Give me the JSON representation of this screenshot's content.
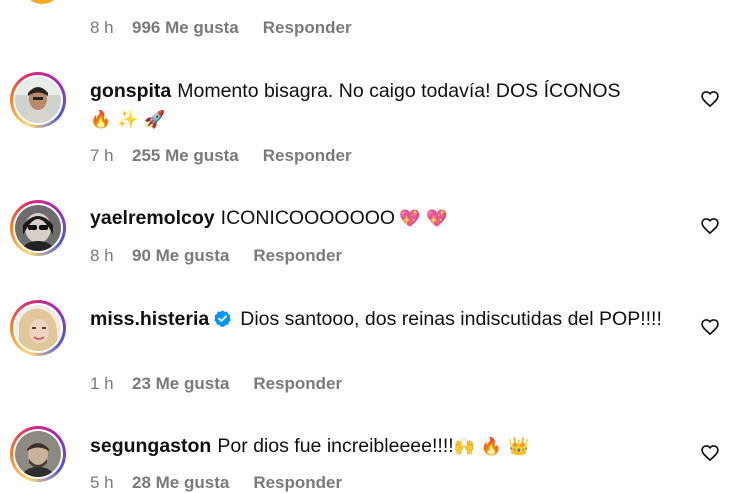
{
  "top_comment": {
    "time": "8 h",
    "likes": "996 Me gusta",
    "reply": "Responder"
  },
  "comments": [
    {
      "username": "gonspita",
      "text": "Momento bisagra. No caigo todavía! DOS ÍCONOS",
      "emojis": [
        "🔥",
        "✨",
        "🚀"
      ],
      "time": "7 h",
      "likes": "255 Me gusta",
      "reply": "Responder",
      "verified": false
    },
    {
      "username": "yaelremolcoy",
      "text": "ICONICOOOOOOO",
      "emojis": [
        "💖",
        "💖"
      ],
      "time": "8 h",
      "likes": "90 Me gusta",
      "reply": "Responder",
      "verified": false
    },
    {
      "username": "miss.histeria",
      "text": "Dios santooo, dos reinas indiscutidas del POP!!!!",
      "emojis": [],
      "time": "1 h",
      "likes": "23 Me gusta",
      "reply": "Responder",
      "verified": true
    },
    {
      "username": "segungaston",
      "text": "Por dios fue increibleeee!!!!",
      "emojis": [
        "🙌",
        "🔥",
        "👑"
      ],
      "time": "5 h",
      "likes": "28 Me gusta",
      "reply": "Responder",
      "verified": false
    }
  ],
  "colors": {
    "muted": "#7a7a7a",
    "verified_blue": "#0095f6"
  }
}
